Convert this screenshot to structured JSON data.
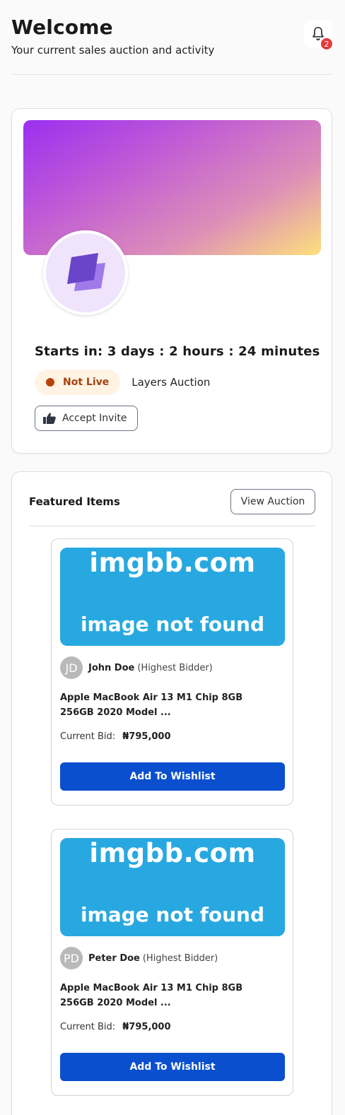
{
  "header": {
    "title": "Welcome",
    "subtitle": "Your current sales auction and activity",
    "notification_count": "2"
  },
  "auction": {
    "countdown": "Starts in: 3 days : 2 hours : 24 minutes",
    "status": "Not Live",
    "name": "Layers Auction",
    "accept_label": "Accept Invite"
  },
  "featured": {
    "title": "Featured Items",
    "view_label": "View Auction",
    "items": [
      {
        "image_line1": "imgbb.com",
        "image_line2": "image not found",
        "avatar_initials": "JD",
        "bidder": "John Doe",
        "bidder_role": "(Highest Bidder)",
        "title": "Apple MacBook Air 13 M1 Chip 8GB 256GB 2020 Model ...",
        "bid_label": "Current Bid:",
        "bid_value": "₦795,000",
        "button_label": "Add To Wishlist"
      },
      {
        "image_line1": "imgbb.com",
        "image_line2": "image not found",
        "avatar_initials": "PD",
        "bidder": "Peter Doe",
        "bidder_role": "(Highest Bidder)",
        "title": "Apple MacBook Air 13 M1 Chip 8GB 256GB 2020 Model ...",
        "bid_label": "Current Bid:",
        "bid_value": "₦795,000",
        "button_label": "Add To Wishlist"
      }
    ]
  },
  "colors": {
    "primary_button": "#0a4fce",
    "status_bg": "#fff3e4",
    "status_text": "#a4420c",
    "badge": "#e23a3a"
  }
}
